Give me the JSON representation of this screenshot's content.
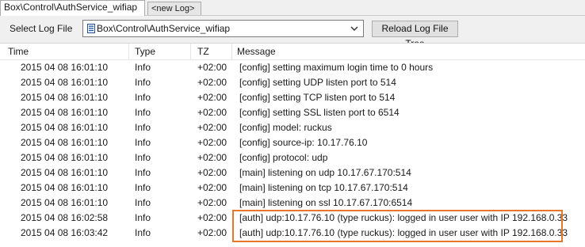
{
  "tabs": {
    "active": "Box\\Control\\AuthService_wifiap",
    "new_log": "<new Log>"
  },
  "toolbar": {
    "select_label": "Select Log File",
    "selected_file": "Box\\Control\\AuthService_wifiap",
    "reload_button": "Reload Log File Tree"
  },
  "table": {
    "columns": [
      "Time",
      "Type",
      "TZ",
      "Message"
    ],
    "rows": [
      {
        "time": "2015 04 08 16:01:10",
        "type": "Info",
        "tz": "+02:00",
        "message": "[config] setting maximum login time to 0 hours"
      },
      {
        "time": "2015 04 08 16:01:10",
        "type": "Info",
        "tz": "+02:00",
        "message": "[config] setting UDP listen port to 514"
      },
      {
        "time": "2015 04 08 16:01:10",
        "type": "Info",
        "tz": "+02:00",
        "message": "[config] setting TCP listen port to 514"
      },
      {
        "time": "2015 04 08 16:01:10",
        "type": "Info",
        "tz": "+02:00",
        "message": "[config] setting SSL listen port to 6514"
      },
      {
        "time": "2015 04 08 16:01:10",
        "type": "Info",
        "tz": "+02:00",
        "message": "[config] model: ruckus"
      },
      {
        "time": "2015 04 08 16:01:10",
        "type": "Info",
        "tz": "+02:00",
        "message": "[config] source-ip: 10.17.76.10"
      },
      {
        "time": "2015 04 08 16:01:10",
        "type": "Info",
        "tz": "+02:00",
        "message": "[config] protocol: udp"
      },
      {
        "time": "2015 04 08 16:01:10",
        "type": "Info",
        "tz": "+02:00",
        "message": "[main] listening on udp 10.17.67.170:514"
      },
      {
        "time": "2015 04 08 16:01:10",
        "type": "Info",
        "tz": "+02:00",
        "message": "[main] listening on tcp 10.17.67.170:514"
      },
      {
        "time": "2015 04 08 16:01:10",
        "type": "Info",
        "tz": "+02:00",
        "message": "[main] listening on ssl 10.17.67.170:6514"
      },
      {
        "time": "2015 04 08 16:02:58",
        "type": "Info",
        "tz": "+02:00",
        "message": "[auth] udp:10.17.76.10 (type ruckus): logged in user user with IP 192.168.0.33"
      },
      {
        "time": "2015 04 08 16:03:42",
        "type": "Info",
        "tz": "+02:00",
        "message": "[auth] udp:10.17.76.10 (type ruckus): logged in user user with IP 192.168.0.33"
      }
    ]
  },
  "highlight_color": "#e8762c",
  "icons": {
    "file": "file-tree-icon",
    "dropdown": "chevron-down-icon"
  }
}
